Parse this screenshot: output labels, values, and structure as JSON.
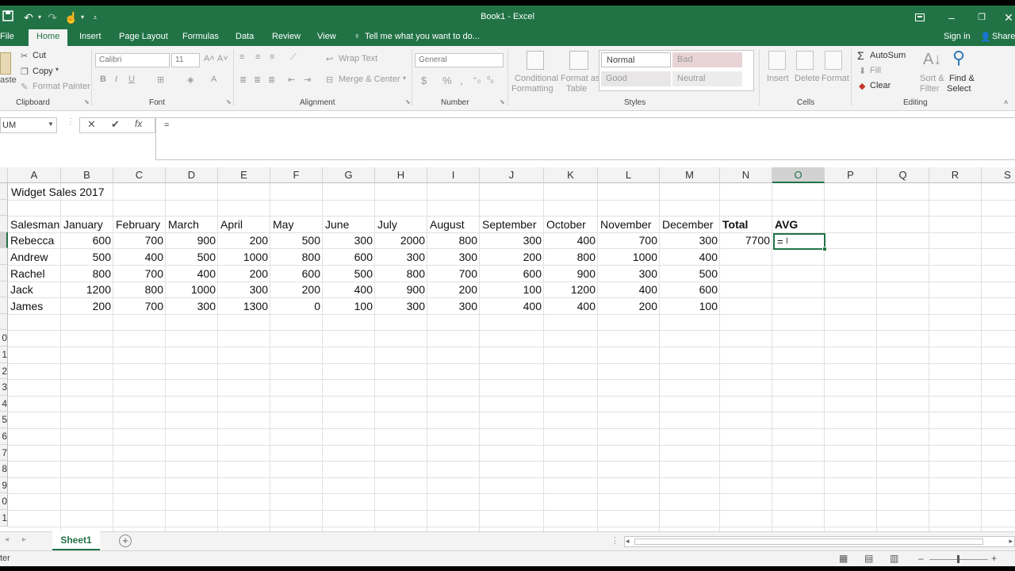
{
  "window": {
    "title": "Book1 - Excel",
    "sign_in": "Sign in",
    "share": "Share"
  },
  "tabs": [
    "File",
    "Home",
    "Insert",
    "Page Layout",
    "Formulas",
    "Data",
    "Review",
    "View"
  ],
  "tell_me": "Tell me what you want to do...",
  "ribbon": {
    "clipboard": {
      "paste": "aste",
      "cut": "Cut",
      "copy": "Copy",
      "format_painter": "Format Painter",
      "label": "Clipboard"
    },
    "font": {
      "name": "Calibri",
      "size": "11",
      "label": "Font"
    },
    "alignment": {
      "wrap_text": "Wrap Text",
      "merge_center": "Merge & Center",
      "label": "Alignment"
    },
    "number": {
      "format": "General",
      "label": "Number"
    },
    "styles": {
      "conditional_1": "Conditional",
      "conditional_2": "Formatting",
      "format_as_1": "Format as",
      "format_as_2": "Table",
      "normal": "Normal",
      "bad": "Bad",
      "good": "Good",
      "neutral": "Neutral",
      "label": "Styles"
    },
    "cells": {
      "insert": "Insert",
      "delete": "Delete",
      "format": "Format",
      "label": "Cells"
    },
    "editing": {
      "autosum": "AutoSum",
      "fill": "Fill",
      "clear": "Clear",
      "sort_1": "Sort &",
      "sort_2": "Filter",
      "find_1": "Find &",
      "find_2": "Select",
      "label": "Editing"
    }
  },
  "formula_bar": {
    "name_box": "UM",
    "content": "="
  },
  "columns": [
    "A",
    "B",
    "C",
    "D",
    "E",
    "F",
    "G",
    "H",
    "I",
    "J",
    "K",
    "L",
    "M",
    "N",
    "O",
    "P",
    "Q",
    "R",
    "S"
  ],
  "row_numbers": [
    "",
    "",
    "",
    "",
    "",
    "",
    "",
    "",
    "",
    "0",
    "1",
    "2",
    "3",
    "4",
    "5",
    "6",
    "7",
    "8",
    "9",
    "0",
    "1"
  ],
  "sheet": {
    "title": "Widget Sales 2017",
    "headers": [
      "Salesman",
      "January",
      "February",
      "March",
      "April",
      "May",
      "June",
      "July",
      "August",
      "September",
      "October",
      "November",
      "December",
      "Total",
      "AVG"
    ],
    "rows": [
      {
        "name": "Rebecca",
        "values": [
          "600",
          "700",
          "900",
          "200",
          "500",
          "300",
          "2000",
          "800",
          "300",
          "400",
          "700",
          "300"
        ],
        "total": "7700",
        "avg": "="
      },
      {
        "name": "Andrew",
        "values": [
          "500",
          "400",
          "500",
          "1000",
          "800",
          "600",
          "300",
          "300",
          "200",
          "800",
          "1000",
          "400"
        ]
      },
      {
        "name": "Rachel",
        "values": [
          "800",
          "700",
          "400",
          "200",
          "600",
          "500",
          "800",
          "700",
          "600",
          "900",
          "300",
          "500"
        ]
      },
      {
        "name": "Jack",
        "values": [
          "1200",
          "800",
          "1000",
          "300",
          "200",
          "400",
          "900",
          "200",
          "100",
          "1200",
          "400",
          "600"
        ]
      },
      {
        "name": "James",
        "values": [
          "200",
          "700",
          "300",
          "1300",
          "0",
          "100",
          "300",
          "300",
          "400",
          "400",
          "200",
          "100"
        ]
      }
    ]
  },
  "sheet_tabs": [
    "Sheet1"
  ],
  "status": {
    "mode": "ter"
  },
  "colors": {
    "accent": "#217346"
  }
}
